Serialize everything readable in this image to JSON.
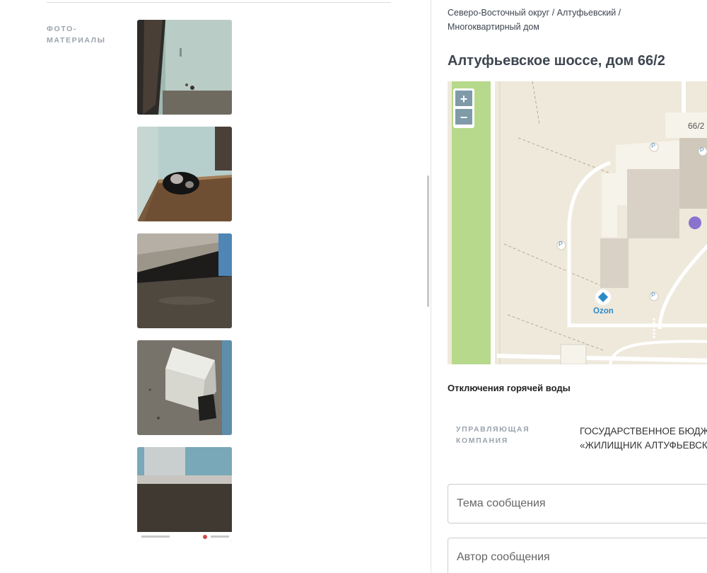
{
  "left": {
    "photos_label_line1": "ФОТО-",
    "photos_label_line2": "МАТЕРИАЛЫ"
  },
  "breadcrumb": {
    "okrug": "Северо-Восточный округ",
    "district": "Алтуфьевский",
    "type": "Многоквартирный дом"
  },
  "address": "Алтуфьевское шоссе, дом 66/2",
  "map": {
    "zoom_in": "+",
    "zoom_out": "−",
    "house_number": "66/2",
    "poi_label": "Ozon",
    "parking_label": "P"
  },
  "hot_water_title": "Отключения горячей воды",
  "management": {
    "label_line1": "УПРАВЛЯЮЩАЯ",
    "label_line2": "КОМПАНИЯ",
    "value_line1": "ГОСУДАРСТВЕННОЕ БЮДЖЕТНОЕ",
    "value_line2": "«ЖИЛИЩНИК АЛТУФЬЕВСКОГО»"
  },
  "form": {
    "subject_placeholder": "Тема сообщения",
    "author_placeholder": "Автор сообщения"
  }
}
